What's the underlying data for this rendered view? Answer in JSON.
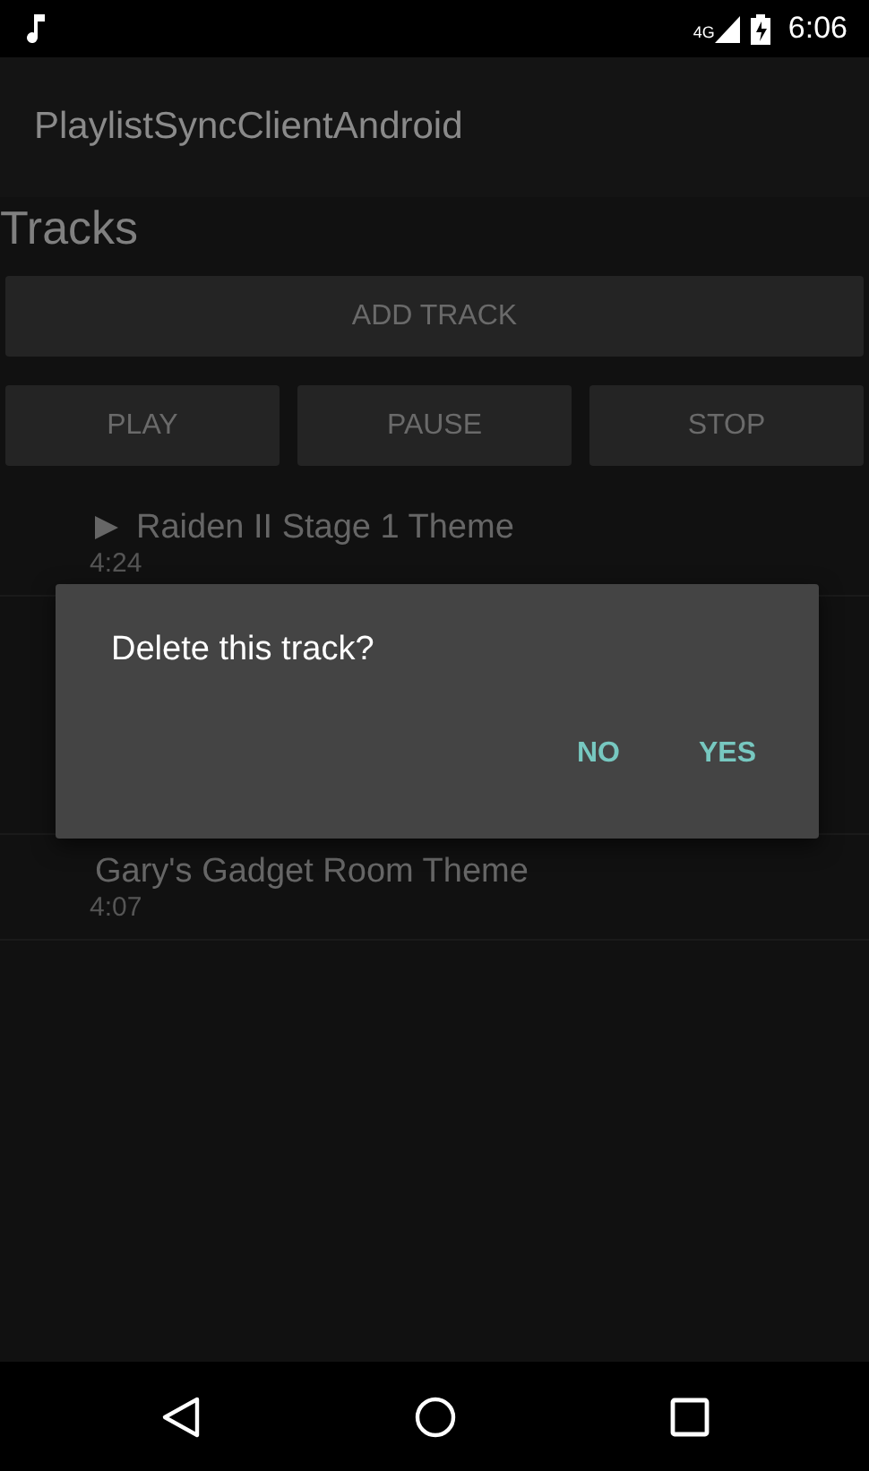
{
  "status_bar": {
    "time": "6:06",
    "network": "4G"
  },
  "app_bar": {
    "title": "PlaylistSyncClientAndroid"
  },
  "heading": "Tracks",
  "add_button": "ADD TRACK",
  "controls": [
    "PLAY",
    "PAUSE",
    "STOP"
  ],
  "tracks": [
    {
      "title": "Raiden II Stage 1 Theme",
      "duration": "4:24",
      "playing": true
    },
    {
      "title": "Gary's Gadget Room Theme",
      "duration": "4:07",
      "playing": false
    }
  ],
  "dialog": {
    "message": "Delete this track?",
    "buttons": [
      "NO",
      "YES"
    ]
  }
}
